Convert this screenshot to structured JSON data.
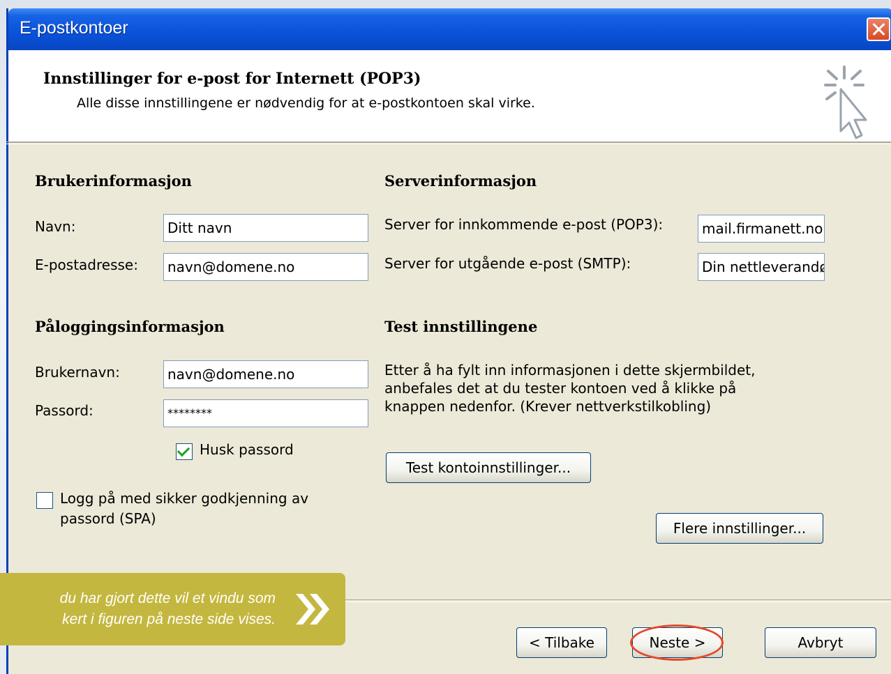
{
  "window": {
    "title": "E-postkontoer"
  },
  "header": {
    "title": "Innstillinger for e-post for Internett  (POP3)",
    "subtitle": "Alle disse innstillingene er nødvendig for at e-postkontoen skal virke."
  },
  "user_info": {
    "heading": "Brukerinformasjon",
    "name_label": "Navn:",
    "name_value": "Ditt navn",
    "email_label": "E-postadresse:",
    "email_value": "navn@domene.no"
  },
  "server_info": {
    "heading": "Serverinformasjon",
    "incoming_label": "Server for innkommende e-post (POP3):",
    "incoming_value": "mail.firmanett.no",
    "outgoing_label": "Server for utgående e-post (SMTP):",
    "outgoing_value": "Din nettleverandør"
  },
  "logon_info": {
    "heading": "Påloggingsinformasjon",
    "username_label": "Brukernavn:",
    "username_value": "navn@domene.no",
    "password_label": "Passord:",
    "password_value": "********",
    "remember_label": "Husk passord",
    "remember_checked": true,
    "spa_label_1": "Logg på med sikker godkjenning av",
    "spa_label_2": "passord (SPA)",
    "spa_checked": false
  },
  "test": {
    "heading": "Test innstillingene",
    "text_1": "Etter å ha fylt inn informasjonen i dette skjermbildet,",
    "text_2": "anbefales det at du tester kontoen ved å klikke på",
    "text_3": "knappen nedenfor. (Krever nettverkstilkobling)",
    "test_button": "Test kontoinnstillinger...",
    "more_button": "Flere innstillinger..."
  },
  "footer": {
    "back": "< Tilbake",
    "next": "Neste >",
    "cancel": "Avbryt"
  },
  "callout": {
    "line_1": "du har gjort dette vil et vindu som",
    "line_2": "kert i figuren på neste side vises."
  },
  "colors": {
    "titlebar": "#0a52d9",
    "callout": "#c4b73f",
    "highlight": "#e34a2c"
  }
}
